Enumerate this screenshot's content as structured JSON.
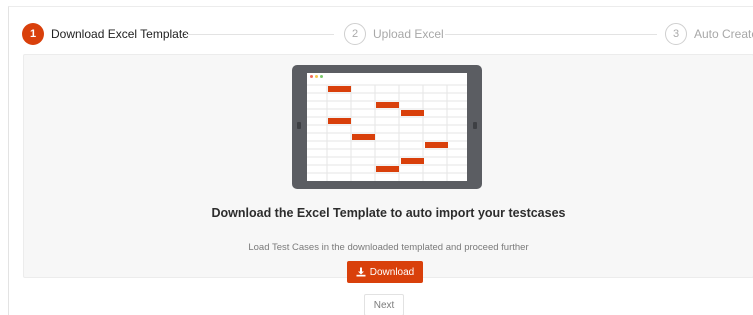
{
  "stepper": {
    "steps": [
      {
        "number": "1",
        "label": "Download Excel Template",
        "state": "active"
      },
      {
        "number": "2",
        "label": "Upload Excel",
        "state": "inactive"
      },
      {
        "number": "3",
        "label": "Auto Create",
        "state": "inactive"
      }
    ]
  },
  "illustration": {
    "icon": "spreadsheet-tablet-illustration",
    "cell_color": "#d9400b",
    "dot_colors": [
      "#f26b5b",
      "#f5c64f",
      "#7bc86c"
    ]
  },
  "content": {
    "headline": "Download the Excel Template to auto import your testcases",
    "subline": "Load Test Cases in the downloaded templated and proceed further",
    "download_label": "Download",
    "download_icon": "download-icon"
  },
  "footer": {
    "next_label": "Next"
  },
  "colors": {
    "accent": "#d9400b"
  }
}
